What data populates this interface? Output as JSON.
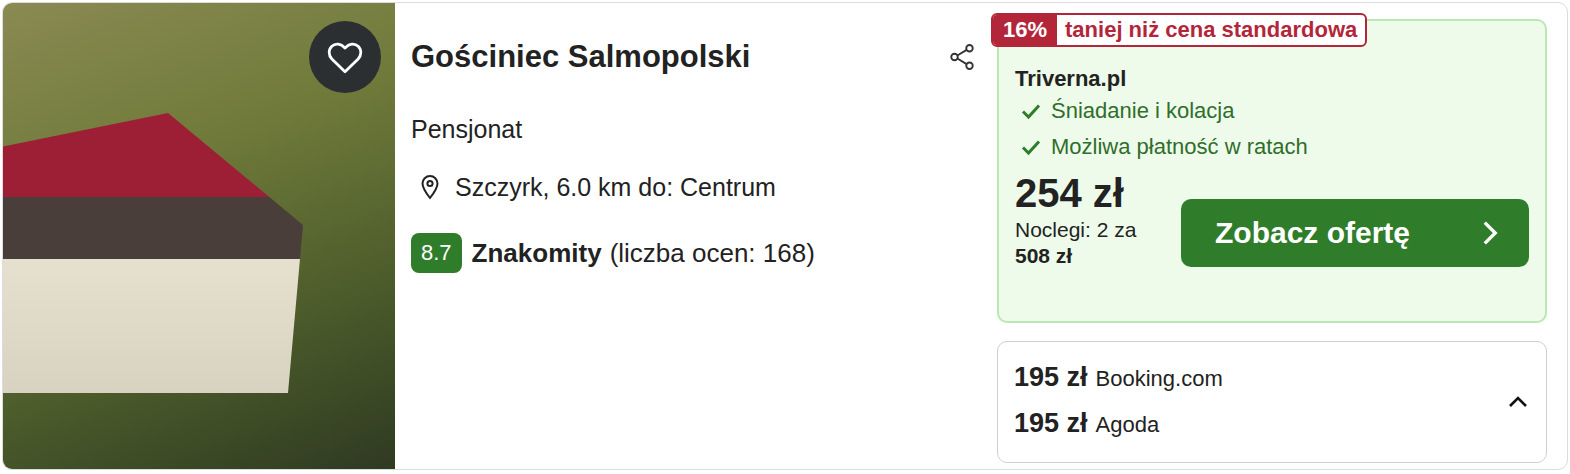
{
  "listing": {
    "name": "Gościniec Salmopolski",
    "type": "Pensjonat",
    "location": "Szczyrk, 6.0 km do: Centrum",
    "favorite": false,
    "rating": {
      "score": "8.7",
      "label": "Znakomity",
      "count": "(liczba ocen: 168)"
    }
  },
  "deal": {
    "discount": "16%",
    "discount_label": "taniej niż cena standardowa",
    "provider": "Triverna.pl",
    "features": [
      "Śniadanie i kolacja",
      "Możliwa płatność w ratach"
    ],
    "price": "254 zł",
    "nights_label": "Noclegi: 2 za",
    "total": "508 zł",
    "button": "Zobacz ofertę"
  },
  "other_offers": {
    "expanded": true,
    "items": [
      {
        "price": "195 zł",
        "provider": "Booking.com"
      },
      {
        "price": "195 zł",
        "provider": "Agoda"
      }
    ]
  }
}
